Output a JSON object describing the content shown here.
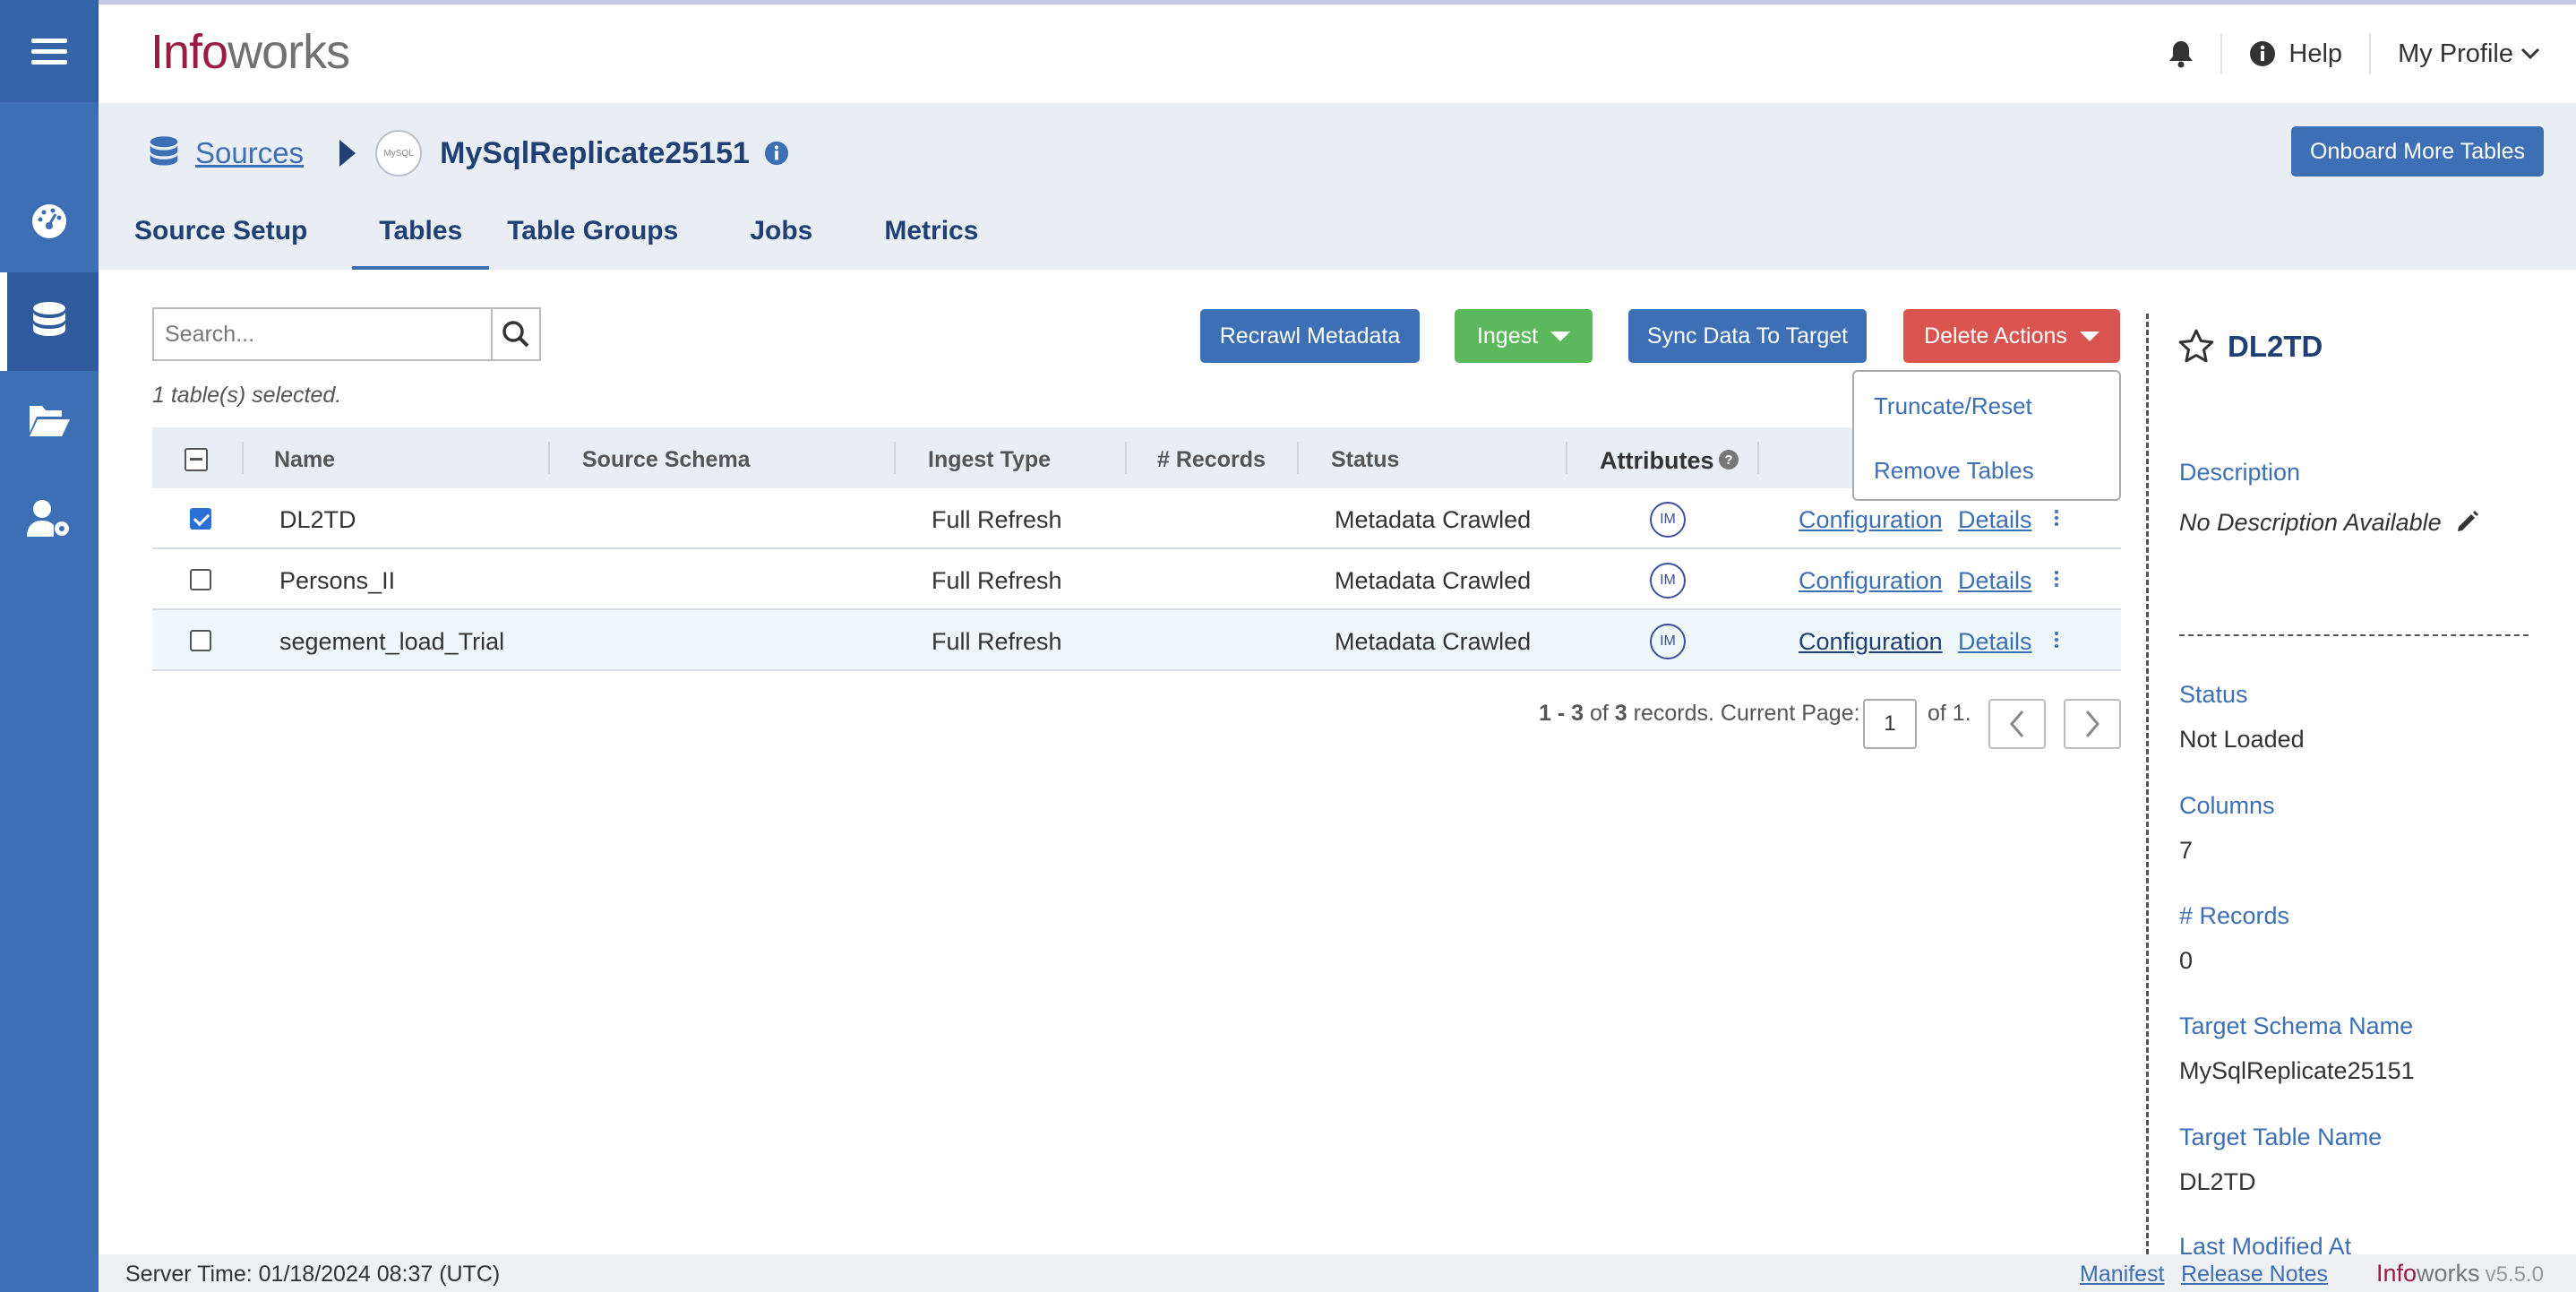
{
  "app": {
    "logo_part1": "Info",
    "logo_part2": "works"
  },
  "header": {
    "help": "Help",
    "profile": "My Profile"
  },
  "breadcrumb": {
    "sources": "Sources",
    "source_name": "MySqlReplicate25151",
    "source_icon_text": "MySQL"
  },
  "onboard_button": "Onboard More Tables",
  "tabs": [
    {
      "label": "Source Setup"
    },
    {
      "label": "Tables"
    },
    {
      "label": "Table Groups"
    },
    {
      "label": "Jobs"
    },
    {
      "label": "Metrics"
    }
  ],
  "active_tab": "Tables",
  "search": {
    "placeholder": "Search..."
  },
  "selection_info": "1 table(s) selected.",
  "toolbar": {
    "recrawl": "Recrawl Metadata",
    "ingest": "Ingest",
    "sync": "Sync Data To Target",
    "delete": "Delete Actions"
  },
  "delete_menu": [
    "Truncate/Reset",
    "Remove Tables"
  ],
  "table": {
    "columns": [
      "Name",
      "Source Schema",
      "Ingest Type",
      "# Records",
      "Status",
      "Attributes"
    ],
    "rows": [
      {
        "name": "DL2TD",
        "schema": "",
        "ingest_type": "Full Refresh",
        "records": "",
        "status": "Metadata Crawled",
        "attr": "IM",
        "config": "Configuration",
        "details": "Details",
        "checked": true
      },
      {
        "name": "Persons_II",
        "schema": "",
        "ingest_type": "Full Refresh",
        "records": "",
        "status": "Metadata Crawled",
        "attr": "IM",
        "config": "Configuration",
        "details": "Details",
        "checked": false
      },
      {
        "name": "segement_load_Trial",
        "schema": "",
        "ingest_type": "Full Refresh",
        "records": "",
        "status": "Metadata Crawled",
        "attr": "IM",
        "config": "Configuration",
        "details": "Details",
        "checked": false
      }
    ]
  },
  "pagination": {
    "range": "1 - 3",
    "of": "of",
    "total": "3",
    "records_text": "records. Current Page:",
    "current_page": "1",
    "of_pages": "of 1."
  },
  "details_panel": {
    "title": "DL2TD",
    "description_label": "Description",
    "description_value": "No Description Available",
    "status_label": "Status",
    "status_value": "Not Loaded",
    "columns_label": "Columns",
    "columns_value": "7",
    "records_label": "# Records",
    "records_value": "0",
    "target_schema_label": "Target Schema Name",
    "target_schema_value": "MySqlReplicate25151",
    "target_table_label": "Target Table Name",
    "target_table_value": "DL2TD",
    "last_modified_label": "Last Modified At"
  },
  "footer": {
    "server_time": "Server Time: 01/18/2024 08:37 (UTC)",
    "manifest": "Manifest",
    "release_notes": "Release Notes",
    "brand_part1": "Info",
    "brand_part2": "works",
    "version": "v5.5.0"
  },
  "colors": {
    "primary": "#3d6fb5",
    "success": "#5cb85c",
    "danger": "#d9534f",
    "brand": "#9b1b43",
    "rail": "#3d6fb5"
  }
}
